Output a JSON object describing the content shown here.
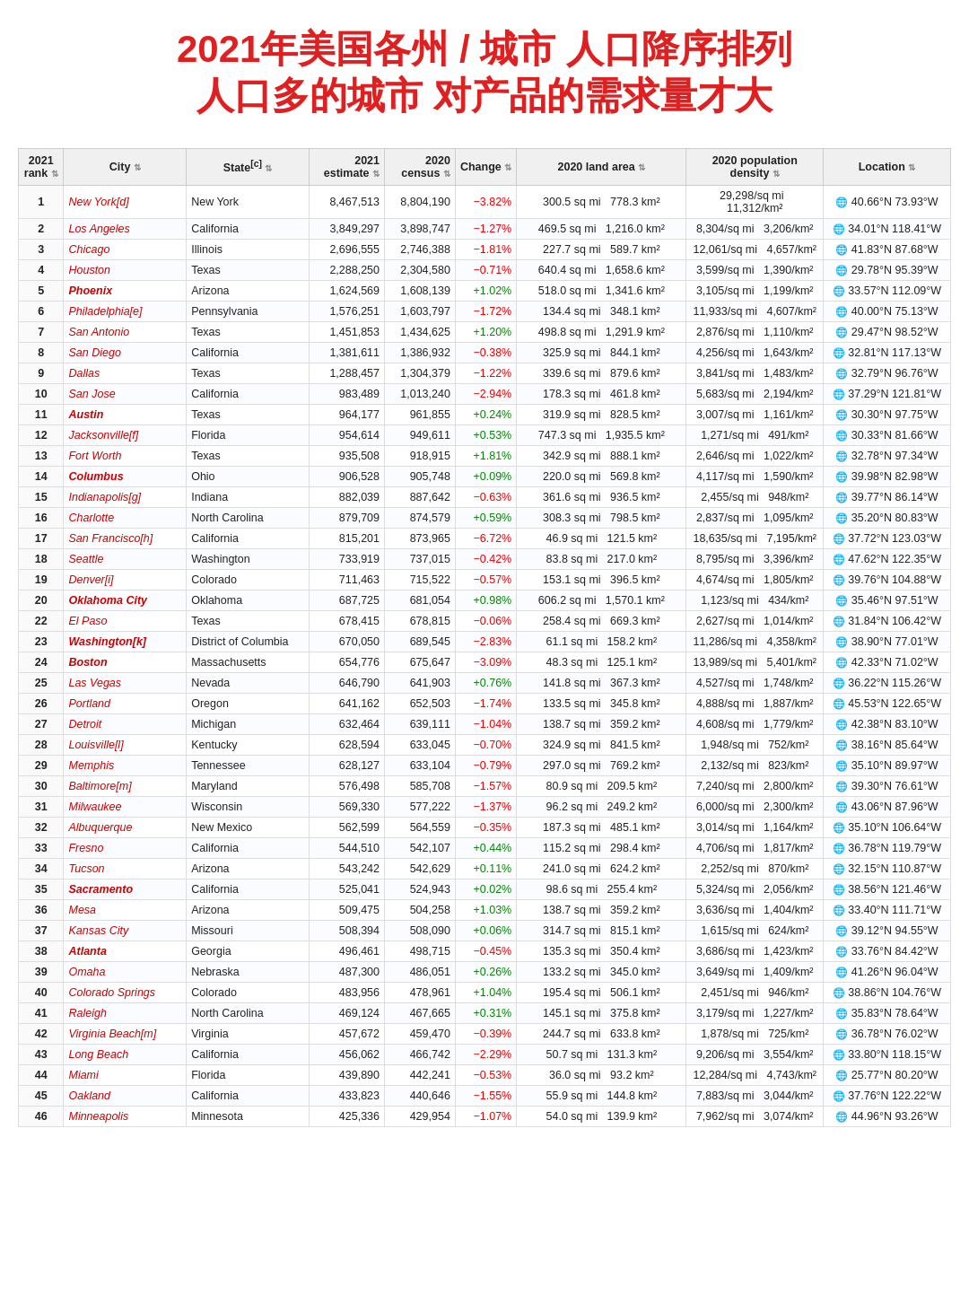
{
  "title": {
    "line1": "2021年美国各州 / 城市 人口降序排列",
    "line2": "人口多的城市 对产品的需求量才大"
  },
  "table": {
    "headers": [
      "2021 rank",
      "City",
      "State[c]",
      "2021 estimate",
      "2020 census",
      "Change",
      "2020 land area",
      "2020 population density",
      "Location"
    ],
    "rows": [
      {
        "rank": "1",
        "city": "New York[d]",
        "city_style": "italic",
        "state": "New York",
        "est": "8,467,513",
        "census": "8,804,190",
        "change": "−3.82%",
        "change_type": "neg",
        "land_mi": "300.5 sq mi",
        "land_km": "778.3 km²",
        "den_mi": "29,298/sq mi",
        "den_km": "11,312/km²",
        "loc": "40.66°N 73.93°W"
      },
      {
        "rank": "2",
        "city": "Los Angeles",
        "city_style": "italic",
        "state": "California",
        "est": "3,849,297",
        "census": "3,898,747",
        "change": "−1.27%",
        "change_type": "neg",
        "land_mi": "469.5 sq mi",
        "land_km": "1,216.0 km²",
        "den_mi": "8,304/sq mi",
        "den_km": "3,206/km²",
        "loc": "34.01°N 118.41°W"
      },
      {
        "rank": "3",
        "city": "Chicago",
        "city_style": "italic",
        "state": "Illinois",
        "est": "2,696,555",
        "census": "2,746,388",
        "change": "−1.81%",
        "change_type": "neg",
        "land_mi": "227.7 sq mi",
        "land_km": "589.7 km²",
        "den_mi": "12,061/sq mi",
        "den_km": "4,657/km²",
        "loc": "41.83°N 87.68°W"
      },
      {
        "rank": "4",
        "city": "Houston",
        "city_style": "italic",
        "state": "Texas",
        "est": "2,288,250",
        "census": "2,304,580",
        "change": "−0.71%",
        "change_type": "neg",
        "land_mi": "640.4 sq mi",
        "land_km": "1,658.6 km²",
        "den_mi": "3,599/sq mi",
        "den_km": "1,390/km²",
        "loc": "29.78°N 95.39°W"
      },
      {
        "rank": "5",
        "city": "Phoenix",
        "city_style": "bold_italic",
        "state": "Arizona",
        "est": "1,624,569",
        "census": "1,608,139",
        "change": "+1.02%",
        "change_type": "pos",
        "land_mi": "518.0 sq mi",
        "land_km": "1,341.6 km²",
        "den_mi": "3,105/sq mi",
        "den_km": "1,199/km²",
        "loc": "33.57°N 112.09°W"
      },
      {
        "rank": "6",
        "city": "Philadelphia[e]",
        "city_style": "italic",
        "state": "Pennsylvania",
        "est": "1,576,251",
        "census": "1,603,797",
        "change": "−1.72%",
        "change_type": "neg",
        "land_mi": "134.4 sq mi",
        "land_km": "348.1 km²",
        "den_mi": "11,933/sq mi",
        "den_km": "4,607/km²",
        "loc": "40.00°N 75.13°W"
      },
      {
        "rank": "7",
        "city": "San Antonio",
        "city_style": "italic",
        "state": "Texas",
        "est": "1,451,853",
        "census": "1,434,625",
        "change": "+1.20%",
        "change_type": "pos",
        "land_mi": "498.8 sq mi",
        "land_km": "1,291.9 km²",
        "den_mi": "2,876/sq mi",
        "den_km": "1,110/km²",
        "loc": "29.47°N 98.52°W"
      },
      {
        "rank": "8",
        "city": "San Diego",
        "city_style": "italic",
        "state": "California",
        "est": "1,381,611",
        "census": "1,386,932",
        "change": "−0.38%",
        "change_type": "neg",
        "land_mi": "325.9 sq mi",
        "land_km": "844.1 km²",
        "den_mi": "4,256/sq mi",
        "den_km": "1,643/km²",
        "loc": "32.81°N 117.13°W"
      },
      {
        "rank": "9",
        "city": "Dallas",
        "city_style": "italic",
        "state": "Texas",
        "est": "1,288,457",
        "census": "1,304,379",
        "change": "−1.22%",
        "change_type": "neg",
        "land_mi": "339.6 sq mi",
        "land_km": "879.6 km²",
        "den_mi": "3,841/sq mi",
        "den_km": "1,483/km²",
        "loc": "32.79°N 96.76°W"
      },
      {
        "rank": "10",
        "city": "San Jose",
        "city_style": "italic",
        "state": "California",
        "est": "983,489",
        "census": "1,013,240",
        "change": "−2.94%",
        "change_type": "neg",
        "land_mi": "178.3 sq mi",
        "land_km": "461.8 km²",
        "den_mi": "5,683/sq mi",
        "den_km": "2,194/km²",
        "loc": "37.29°N 121.81°W"
      },
      {
        "rank": "11",
        "city": "Austin",
        "city_style": "bold_italic",
        "state": "Texas",
        "est": "964,177",
        "census": "961,855",
        "change": "+0.24%",
        "change_type": "pos",
        "land_mi": "319.9 sq mi",
        "land_km": "828.5 km²",
        "den_mi": "3,007/sq mi",
        "den_km": "1,161/km²",
        "loc": "30.30°N 97.75°W"
      },
      {
        "rank": "12",
        "city": "Jacksonville[f]",
        "city_style": "italic",
        "state": "Florida",
        "est": "954,614",
        "census": "949,611",
        "change": "+0.53%",
        "change_type": "pos",
        "land_mi": "747.3 sq mi",
        "land_km": "1,935.5 km²",
        "den_mi": "1,271/sq mi",
        "den_km": "491/km²",
        "loc": "30.33°N 81.66°W"
      },
      {
        "rank": "13",
        "city": "Fort Worth",
        "city_style": "italic",
        "state": "Texas",
        "est": "935,508",
        "census": "918,915",
        "change": "+1.81%",
        "change_type": "pos",
        "land_mi": "342.9 sq mi",
        "land_km": "888.1 km²",
        "den_mi": "2,646/sq mi",
        "den_km": "1,022/km²",
        "loc": "32.78°N 97.34°W"
      },
      {
        "rank": "14",
        "city": "Columbus",
        "city_style": "bold_italic",
        "state": "Ohio",
        "est": "906,528",
        "census": "905,748",
        "change": "+0.09%",
        "change_type": "pos",
        "land_mi": "220.0 sq mi",
        "land_km": "569.8 km²",
        "den_mi": "4,117/sq mi",
        "den_km": "1,590/km²",
        "loc": "39.98°N 82.98°W"
      },
      {
        "rank": "15",
        "city": "Indianapolis[g]",
        "city_style": "italic",
        "state": "Indiana",
        "est": "882,039",
        "census": "887,642",
        "change": "−0.63%",
        "change_type": "neg",
        "land_mi": "361.6 sq mi",
        "land_km": "936.5 km²",
        "den_mi": "2,455/sq mi",
        "den_km": "948/km²",
        "loc": "39.77°N 86.14°W"
      },
      {
        "rank": "16",
        "city": "Charlotte",
        "city_style": "italic",
        "state": "North Carolina",
        "est": "879,709",
        "census": "874,579",
        "change": "+0.59%",
        "change_type": "pos",
        "land_mi": "308.3 sq mi",
        "land_km": "798.5 km²",
        "den_mi": "2,837/sq mi",
        "den_km": "1,095/km²",
        "loc": "35.20°N 80.83°W"
      },
      {
        "rank": "17",
        "city": "San Francisco[h]",
        "city_style": "italic",
        "state": "California",
        "est": "815,201",
        "census": "873,965",
        "change": "−6.72%",
        "change_type": "neg",
        "land_mi": "46.9 sq mi",
        "land_km": "121.5 km²",
        "den_mi": "18,635/sq mi",
        "den_km": "7,195/km²",
        "loc": "37.72°N 123.03°W"
      },
      {
        "rank": "18",
        "city": "Seattle",
        "city_style": "italic",
        "state": "Washington",
        "est": "733,919",
        "census": "737,015",
        "change": "−0.42%",
        "change_type": "neg",
        "land_mi": "83.8 sq mi",
        "land_km": "217.0 km²",
        "den_mi": "8,795/sq mi",
        "den_km": "3,396/km²",
        "loc": "47.62°N 122.35°W"
      },
      {
        "rank": "19",
        "city": "Denver[i]",
        "city_style": "italic",
        "state": "Colorado",
        "est": "711,463",
        "census": "715,522",
        "change": "−0.57%",
        "change_type": "neg",
        "land_mi": "153.1 sq mi",
        "land_km": "396.5 km²",
        "den_mi": "4,674/sq mi",
        "den_km": "1,805/km²",
        "loc": "39.76°N 104.88°W"
      },
      {
        "rank": "20",
        "city": "Oklahoma City",
        "city_style": "bold_italic",
        "state": "Oklahoma",
        "est": "687,725",
        "census": "681,054",
        "change": "+0.98%",
        "change_type": "pos",
        "land_mi": "606.2 sq mi",
        "land_km": "1,570.1 km²",
        "den_mi": "1,123/sq mi",
        "den_km": "434/km²",
        "loc": "35.46°N 97.51°W"
      },
      {
        "rank": "22",
        "city": "El Paso",
        "city_style": "italic",
        "state": "Texas",
        "est": "678,415",
        "census": "678,815",
        "change": "−0.06%",
        "change_type": "neg",
        "land_mi": "258.4 sq mi",
        "land_km": "669.3 km²",
        "den_mi": "2,627/sq mi",
        "den_km": "1,014/km²",
        "loc": "31.84°N 106.42°W"
      },
      {
        "rank": "23",
        "city": "Washington[k]",
        "city_style": "bold_italic",
        "state": "District of Columbia",
        "est": "670,050",
        "census": "689,545",
        "change": "−2.83%",
        "change_type": "neg",
        "land_mi": "61.1 sq mi",
        "land_km": "158.2 km²",
        "den_mi": "11,286/sq mi",
        "den_km": "4,358/km²",
        "loc": "38.90°N 77.01°W"
      },
      {
        "rank": "24",
        "city": "Boston",
        "city_style": "bold_italic",
        "state": "Massachusetts",
        "est": "654,776",
        "census": "675,647",
        "change": "−3.09%",
        "change_type": "neg",
        "land_mi": "48.3 sq mi",
        "land_km": "125.1 km²",
        "den_mi": "13,989/sq mi",
        "den_km": "5,401/km²",
        "loc": "42.33°N 71.02°W"
      },
      {
        "rank": "25",
        "city": "Las Vegas",
        "city_style": "italic",
        "state": "Nevada",
        "est": "646,790",
        "census": "641,903",
        "change": "+0.76%",
        "change_type": "pos",
        "land_mi": "141.8 sq mi",
        "land_km": "367.3 km²",
        "den_mi": "4,527/sq mi",
        "den_km": "1,748/km²",
        "loc": "36.22°N 115.26°W"
      },
      {
        "rank": "26",
        "city": "Portland",
        "city_style": "italic",
        "state": "Oregon",
        "est": "641,162",
        "census": "652,503",
        "change": "−1.74%",
        "change_type": "neg",
        "land_mi": "133.5 sq mi",
        "land_km": "345.8 km²",
        "den_mi": "4,888/sq mi",
        "den_km": "1,887/km²",
        "loc": "45.53°N 122.65°W"
      },
      {
        "rank": "27",
        "city": "Detroit",
        "city_style": "italic",
        "state": "Michigan",
        "est": "632,464",
        "census": "639,111",
        "change": "−1.04%",
        "change_type": "neg",
        "land_mi": "138.7 sq mi",
        "land_km": "359.2 km²",
        "den_mi": "4,608/sq mi",
        "den_km": "1,779/km²",
        "loc": "42.38°N 83.10°W"
      },
      {
        "rank": "28",
        "city": "Louisville[l]",
        "city_style": "italic",
        "state": "Kentucky",
        "est": "628,594",
        "census": "633,045",
        "change": "−0.70%",
        "change_type": "neg",
        "land_mi": "324.9 sq mi",
        "land_km": "841.5 km²",
        "den_mi": "1,948/sq mi",
        "den_km": "752/km²",
        "loc": "38.16°N 85.64°W"
      },
      {
        "rank": "29",
        "city": "Memphis",
        "city_style": "italic",
        "state": "Tennessee",
        "est": "628,127",
        "census": "633,104",
        "change": "−0.79%",
        "change_type": "neg",
        "land_mi": "297.0 sq mi",
        "land_km": "769.2 km²",
        "den_mi": "2,132/sq mi",
        "den_km": "823/km²",
        "loc": "35.10°N 89.97°W"
      },
      {
        "rank": "30",
        "city": "Baltimore[m]",
        "city_style": "italic",
        "state": "Maryland",
        "est": "576,498",
        "census": "585,708",
        "change": "−1.57%",
        "change_type": "neg",
        "land_mi": "80.9 sq mi",
        "land_km": "209.5 km²",
        "den_mi": "7,240/sq mi",
        "den_km": "2,800/km²",
        "loc": "39.30°N 76.61°W"
      },
      {
        "rank": "31",
        "city": "Milwaukee",
        "city_style": "italic",
        "state": "Wisconsin",
        "est": "569,330",
        "census": "577,222",
        "change": "−1.37%",
        "change_type": "neg",
        "land_mi": "96.2 sq mi",
        "land_km": "249.2 km²",
        "den_mi": "6,000/sq mi",
        "den_km": "2,300/km²",
        "loc": "43.06°N 87.96°W"
      },
      {
        "rank": "32",
        "city": "Albuquerque",
        "city_style": "italic",
        "state": "New Mexico",
        "est": "562,599",
        "census": "564,559",
        "change": "−0.35%",
        "change_type": "neg",
        "land_mi": "187.3 sq mi",
        "land_km": "485.1 km²",
        "den_mi": "3,014/sq mi",
        "den_km": "1,164/km²",
        "loc": "35.10°N 106.64°W"
      },
      {
        "rank": "33",
        "city": "Fresno",
        "city_style": "italic",
        "state": "California",
        "est": "544,510",
        "census": "542,107",
        "change": "+0.44%",
        "change_type": "pos",
        "land_mi": "115.2 sq mi",
        "land_km": "298.4 km²",
        "den_mi": "4,706/sq mi",
        "den_km": "1,817/km²",
        "loc": "36.78°N 119.79°W"
      },
      {
        "rank": "34",
        "city": "Tucson",
        "city_style": "italic",
        "state": "Arizona",
        "est": "543,242",
        "census": "542,629",
        "change": "+0.11%",
        "change_type": "pos",
        "land_mi": "241.0 sq mi",
        "land_km": "624.2 km²",
        "den_mi": "2,252/sq mi",
        "den_km": "870/km²",
        "loc": "32.15°N 110.87°W"
      },
      {
        "rank": "35",
        "city": "Sacramento",
        "city_style": "bold_italic",
        "state": "California",
        "est": "525,041",
        "census": "524,943",
        "change": "+0.02%",
        "change_type": "pos",
        "land_mi": "98.6 sq mi",
        "land_km": "255.4 km²",
        "den_mi": "5,324/sq mi",
        "den_km": "2,056/km²",
        "loc": "38.56°N 121.46°W"
      },
      {
        "rank": "36",
        "city": "Mesa",
        "city_style": "italic",
        "state": "Arizona",
        "est": "509,475",
        "census": "504,258",
        "change": "+1.03%",
        "change_type": "pos",
        "land_mi": "138.7 sq mi",
        "land_km": "359.2 km²",
        "den_mi": "3,636/sq mi",
        "den_km": "1,404/km²",
        "loc": "33.40°N 111.71°W"
      },
      {
        "rank": "37",
        "city": "Kansas City",
        "city_style": "italic",
        "state": "Missouri",
        "est": "508,394",
        "census": "508,090",
        "change": "+0.06%",
        "change_type": "pos",
        "land_mi": "314.7 sq mi",
        "land_km": "815.1 km²",
        "den_mi": "1,615/sq mi",
        "den_km": "624/km²",
        "loc": "39.12°N 94.55°W"
      },
      {
        "rank": "38",
        "city": "Atlanta",
        "city_style": "bold_italic",
        "state": "Georgia",
        "est": "496,461",
        "census": "498,715",
        "change": "−0.45%",
        "change_type": "neg",
        "land_mi": "135.3 sq mi",
        "land_km": "350.4 km²",
        "den_mi": "3,686/sq mi",
        "den_km": "1,423/km²",
        "loc": "33.76°N 84.42°W"
      },
      {
        "rank": "39",
        "city": "Omaha",
        "city_style": "italic",
        "state": "Nebraska",
        "est": "487,300",
        "census": "486,051",
        "change": "+0.26%",
        "change_type": "pos",
        "land_mi": "133.2 sq mi",
        "land_km": "345.0 km²",
        "den_mi": "3,649/sq mi",
        "den_km": "1,409/km²",
        "loc": "41.26°N 96.04°W"
      },
      {
        "rank": "40",
        "city": "Colorado Springs",
        "city_style": "italic",
        "state": "Colorado",
        "est": "483,956",
        "census": "478,961",
        "change": "+1.04%",
        "change_type": "pos",
        "land_mi": "195.4 sq mi",
        "land_km": "506.1 km²",
        "den_mi": "2,451/sq mi",
        "den_km": "946/km²",
        "loc": "38.86°N 104.76°W"
      },
      {
        "rank": "41",
        "city": "Raleigh",
        "city_style": "italic",
        "state": "North Carolina",
        "est": "469,124",
        "census": "467,665",
        "change": "+0.31%",
        "change_type": "pos",
        "land_mi": "145.1 sq mi",
        "land_km": "375.8 km²",
        "den_mi": "3,179/sq mi",
        "den_km": "1,227/km²",
        "loc": "35.83°N 78.64°W"
      },
      {
        "rank": "42",
        "city": "Virginia Beach[m]",
        "city_style": "italic",
        "state": "Virginia",
        "est": "457,672",
        "census": "459,470",
        "change": "−0.39%",
        "change_type": "neg",
        "land_mi": "244.7 sq mi",
        "land_km": "633.8 km²",
        "den_mi": "1,878/sq mi",
        "den_km": "725/km²",
        "loc": "36.78°N 76.02°W"
      },
      {
        "rank": "43",
        "city": "Long Beach",
        "city_style": "italic",
        "state": "California",
        "est": "456,062",
        "census": "466,742",
        "change": "−2.29%",
        "change_type": "neg",
        "land_mi": "50.7 sq mi",
        "land_km": "131.3 km²",
        "den_mi": "9,206/sq mi",
        "den_km": "3,554/km²",
        "loc": "33.80°N 118.15°W"
      },
      {
        "rank": "44",
        "city": "Miami",
        "city_style": "italic",
        "state": "Florida",
        "est": "439,890",
        "census": "442,241",
        "change": "−0.53%",
        "change_type": "neg",
        "land_mi": "36.0 sq mi",
        "land_km": "93.2 km²",
        "den_mi": "12,284/sq mi",
        "den_km": "4,743/km²",
        "loc": "25.77°N 80.20°W"
      },
      {
        "rank": "45",
        "city": "Oakland",
        "city_style": "italic",
        "state": "California",
        "est": "433,823",
        "census": "440,646",
        "change": "−1.55%",
        "change_type": "neg",
        "land_mi": "55.9 sq mi",
        "land_km": "144.8 km²",
        "den_mi": "7,883/sq mi",
        "den_km": "3,044/km²",
        "loc": "37.76°N 122.22°W"
      },
      {
        "rank": "46",
        "city": "Minneapolis",
        "city_style": "italic",
        "state": "Minnesota",
        "est": "425,336",
        "census": "429,954",
        "change": "−1.07%",
        "change_type": "neg",
        "land_mi": "54.0 sq mi",
        "land_km": "139.9 km²",
        "den_mi": "7,962/sq mi",
        "den_km": "3,074/km²",
        "loc": "44.96°N 93.26°W"
      }
    ]
  }
}
